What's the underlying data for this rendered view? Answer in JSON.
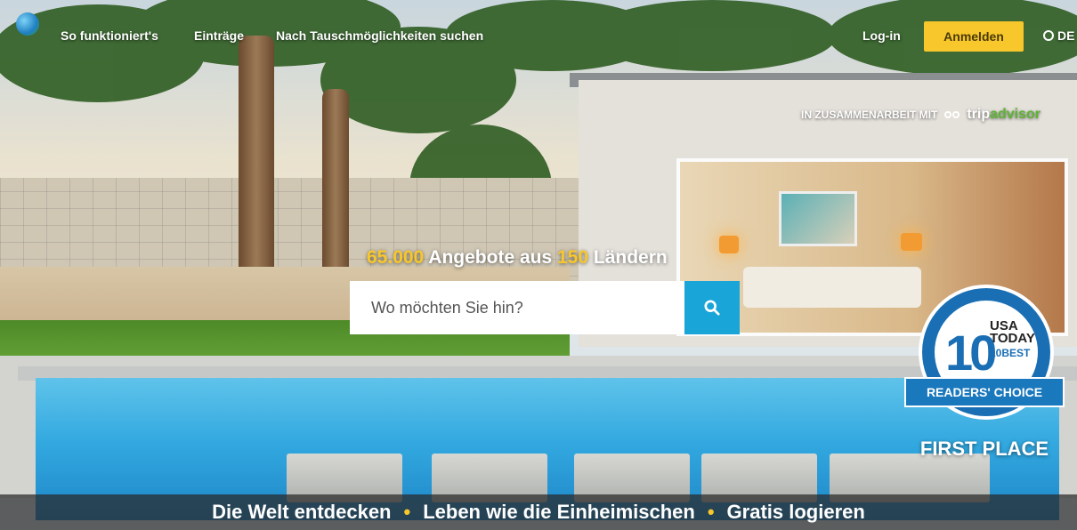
{
  "nav": {
    "links": [
      "So funktioniert's",
      "Einträge",
      "Nach Tauschmöglichkeiten suchen"
    ],
    "login_label": "Log-in",
    "register_label": "Anmelden",
    "language_label": "DE"
  },
  "partner": {
    "text": "IN ZUSAMMENARBEIT MIT",
    "brand_trip": "trip",
    "brand_advisor": "advisor"
  },
  "hero": {
    "offers_count": "65.000",
    "offers_text": "Angebote aus",
    "countries_count": "150",
    "countries_text": "Ländern"
  },
  "search": {
    "placeholder": "Wo möchten Sie hin?"
  },
  "badge": {
    "number": "10",
    "usa": "USA",
    "today": "TODAY",
    "tenbest": "10BEST",
    "ribbon": "READERS' CHOICE",
    "place": "FIRST PLACE"
  },
  "taglines": [
    "Die Welt entdecken",
    "Leben wie die Einheimischen",
    "Gratis logieren"
  ],
  "colors": {
    "accent_yellow": "#f7c72b",
    "search_blue": "#1aa5d8",
    "tripadvisor_green": "#5fb336"
  }
}
